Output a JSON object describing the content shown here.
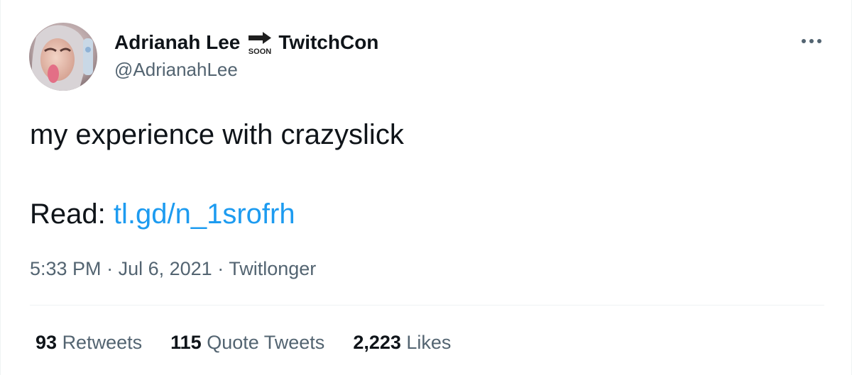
{
  "tweet": {
    "author": {
      "display_name": "Adrianah Lee",
      "display_name_suffix": "TwitchCon",
      "emoji": "soon-arrow",
      "emoji_text": "SOON",
      "handle": "@AdrianahLee",
      "avatar": "profile-photo"
    },
    "text": "my experience with crazyslick",
    "read_label": "Read:",
    "link": "tl.gd/n_1srofrh",
    "meta": {
      "time": "5:33 PM",
      "separator": "·",
      "date": "Jul 6, 2021",
      "source": "Twitlonger"
    },
    "stats": [
      {
        "count": "93",
        "label": "Retweets"
      },
      {
        "count": "115",
        "label": "Quote Tweets"
      },
      {
        "count": "2,223",
        "label": "Likes"
      }
    ],
    "more_icon": "more-horizontal-icon"
  },
  "colors": {
    "text": "#0f1419",
    "secondary": "#536471",
    "link": "#1d9bf0",
    "divider": "#eff3f4"
  }
}
